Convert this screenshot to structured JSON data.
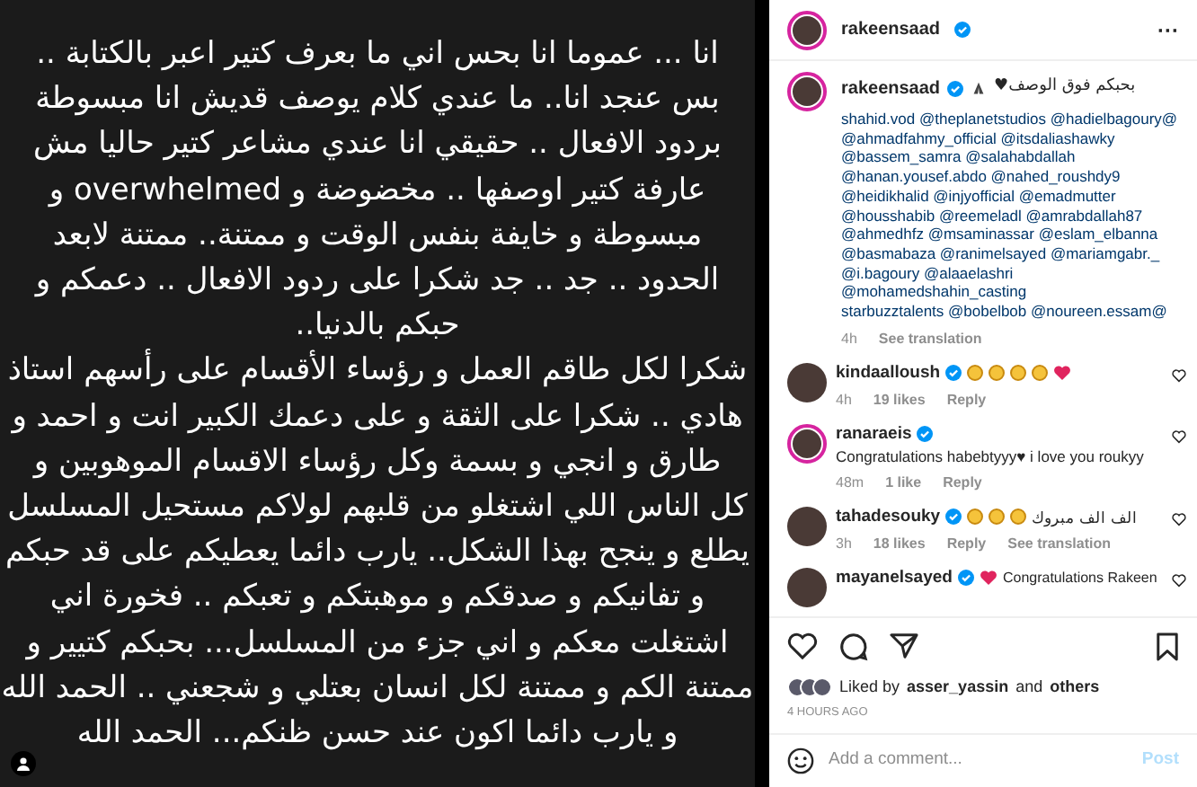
{
  "post_image": {
    "lines": [
      "انا ... عموما انا بحس اني ما بعرف كتير اعبر بالكتابة ..",
      "بس عنجد انا.. ما عندي كلام يوصف قديش انا مبسوطة",
      "بردود الافعال ..  حقيقي انا عندي مشاعر كتير حاليا مش",
      "عارفة كتير اوصفها .. مخضوضة و overwhelmed و",
      "مبسوطة و خايفة بنفس الوقت و ممتنة.. ممتنة لابعد",
      "الحدود .. جد .. جد شكرا على ردود الافعال .. دعمكم و",
      "حبكم بالدنيا..",
      "شكرا لكل طاقم العمل  و رؤساء الأقسام على رأسهم استاذ",
      "هادي .. شكرا على الثقة و على دعمك الكبير انت و احمد و",
      "طارق و انجي و بسمة وكل رؤساء الاقسام الموهوبين  و",
      "كل الناس اللي اشتغلو من قلبهم لولاكم مستحيل المسلسل",
      "يطلع و ينجح بهذا الشكل.. يارب دائما يعطيكم على قد حبكم",
      "و تفانيكم و صدقكم و موهبتكم و تعبكم .. فخورة اني",
      "اشتغلت معكم و اني جزء من المسلسل... بحبكم كتيير و",
      "ممتنة الكم و ممتنة لكل انسان بعتلي و شجعني .. الحمد الله",
      "و يارب دائما اكون عند حسن ظنكم... الحمد الله"
    ]
  },
  "header": {
    "username": "rakeensaad",
    "verified": true,
    "more": "···"
  },
  "caption": {
    "username": "rakeensaad",
    "verified": true,
    "text": "بحبكم فوق الوصف♥",
    "emoji": [
      {
        "kind": "pray"
      }
    ],
    "mentions": [
      "shahid.vod @theplanetstudios @hadielbagoury@",
      "@ahmadfahmy_official @itsdaliashawky",
      "@bassem_samra @salahabdallah",
      "@hanan.yousef.abdo @nahed_roushdy9",
      "@heidikhalid @injyofficial @emadmutter",
      "@housshabib @reemeladl @amrabdallah87",
      "@ahmedhfz @msaminassar @eslam_elbanna",
      "@basmabaza @ranimelsayed @mariamgabr._",
      "@i.bagoury @alaaelashri",
      "@mohamedshahin_casting",
      "starbuzztalents @bobelbob @noureen.essam@"
    ],
    "time": "4h",
    "translate": "See translation"
  },
  "comments": [
    {
      "username": "kindaalloush",
      "verified": true,
      "emoji": [
        {
          "kind": "clap"
        },
        {
          "kind": "clap"
        },
        {
          "kind": "clap"
        },
        {
          "kind": "clap"
        },
        {
          "kind": "heart"
        }
      ],
      "time": "4h",
      "likes": "19 likes",
      "reply": "Reply",
      "story_ring": false
    },
    {
      "username": "ranaraeis",
      "verified": true,
      "text": "Congratulations habebtyyy♥ i love you roukyy",
      "time": "48m",
      "likes": "1 like",
      "reply": "Reply",
      "story_ring": true
    },
    {
      "username": "tahadesouky",
      "verified": true,
      "text": "الف الف مبروك",
      "emoji": [
        {
          "kind": "clap"
        },
        {
          "kind": "clap"
        },
        {
          "kind": "clap"
        }
      ],
      "time": "3h",
      "likes": "18 likes",
      "reply": "Reply",
      "translate": "See translation",
      "story_ring": false
    },
    {
      "username": "mayanelsayed",
      "verified": true,
      "text": "Congratulations Rakeen",
      "emoji": [
        {
          "kind": "heart"
        }
      ],
      "story_ring": false
    }
  ],
  "liked_by": {
    "prefix": "Liked by",
    "user": "asser_yassin",
    "and": "and",
    "others": "others"
  },
  "timestamp": "4 HOURS AGO",
  "comment_box": {
    "placeholder": "Add a comment...",
    "post": "Post"
  }
}
